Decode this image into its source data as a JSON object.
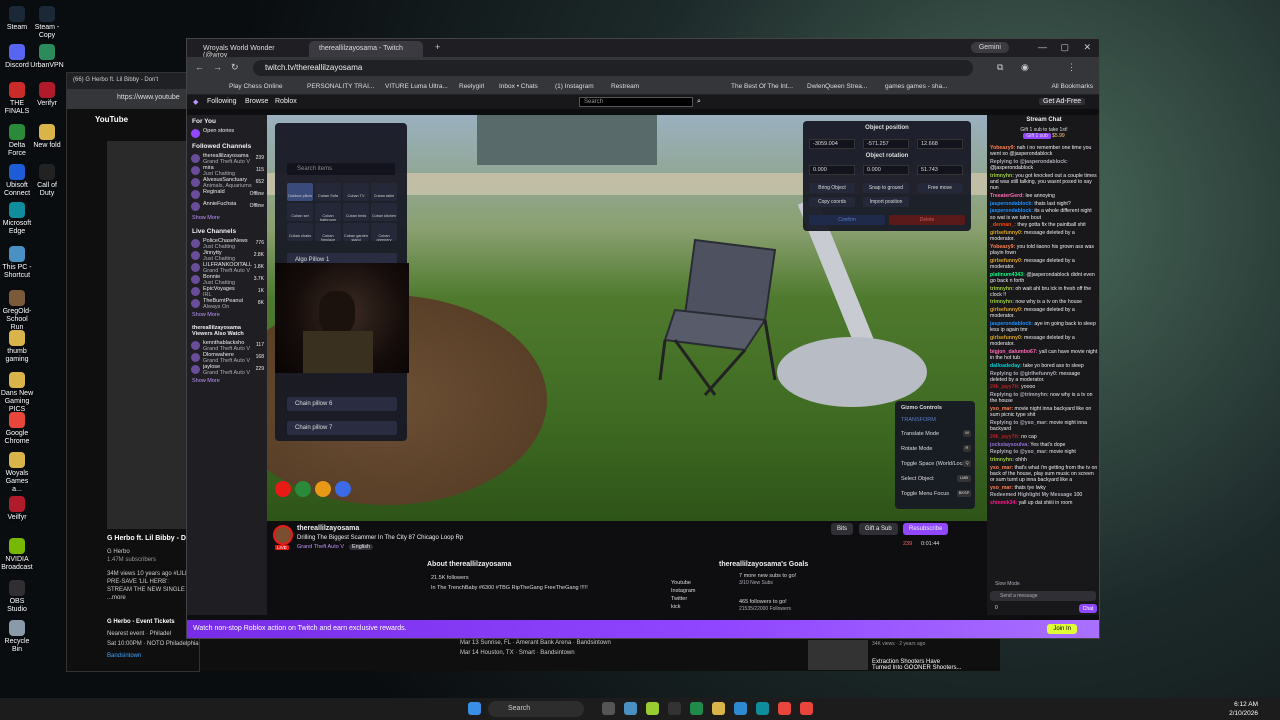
{
  "desktop_icons": [
    {
      "label": "Steam",
      "color": "#1b2838"
    },
    {
      "label": "Steam - Copy",
      "color": "#1b2838"
    },
    {
      "label": "Discord",
      "color": "#5865f2"
    },
    {
      "label": "UrbanVPN",
      "color": "#2d8a5c"
    },
    {
      "label": "THE FINALS",
      "color": "#c92a2a"
    },
    {
      "label": "Delta Force",
      "color": "#2a8a3a"
    },
    {
      "label": "Ubisoft Connect",
      "color": "#1e5bd6"
    },
    {
      "label": "Microsoft Edge",
      "color": "#0f8d9c"
    },
    {
      "label": "This PC - Shortcut",
      "color": "#4a90c2"
    },
    {
      "label": "GregOld-School Run",
      "color": "#7a5a3a"
    },
    {
      "label": "thumb gaming",
      "color": "#d9b44a"
    },
    {
      "label": "Dans New Gaming PICS",
      "color": "#d9b44a"
    },
    {
      "label": "Google Chrome",
      "color": "#e8453c"
    },
    {
      "label": "Woyals Games a...",
      "color": "#d9b44a"
    },
    {
      "label": "Veilfyr",
      "color": "#b11a2a"
    },
    {
      "label": "NVIDIA Broadcast",
      "color": "#76b900"
    },
    {
      "label": "OBS Studio",
      "color": "#302e31"
    },
    {
      "label": "Recycle Bin",
      "color": "#8a9aaa"
    },
    {
      "label": "Verifyr",
      "color": "#b11a2a"
    },
    {
      "label": "New fold",
      "color": "#d9b44a"
    },
    {
      "label": "Call of Duty",
      "color": "#222"
    }
  ],
  "youtube_window": {
    "tab": "(66) G Herbo ft. Lil Bibby - Don't",
    "url": "https://www.youtube",
    "brand": "YouTube",
    "video_title": "G Herbo ft. Lil Bibby - D",
    "channel": "G Herbo",
    "subs": "1.47M subscribers",
    "stats": "34M views  10 years ago  #LILH",
    "desc1": "PRE-SAVE 'LIL HERB':",
    "desc2": "STREAM THE NEW SINGLE 'REA",
    "more": "...more",
    "tickets_title": "G Herbo - Event Tickets",
    "event_label": "Nearest event · Philadel",
    "event_date": "Sat 10:00PM · NOTO Philadelphia",
    "event_month": "FEB",
    "event_day": "21",
    "event_src": "Bandsintown"
  },
  "browser": {
    "tabs": [
      "Wroyals World Wonder (@wroy",
      "thereallilzayosama - Twitch"
    ],
    "gemini": "Gemini",
    "url": "twitch.tv/thereallilzayosama",
    "all_bookmarks": "All Bookmarks",
    "bookmarks": [
      "Play Chess Online",
      "PERSONALITY TRAI...",
      "VITURE Luma Ultra...",
      "Reelygirl",
      "Inbox • Chats",
      "(1) Instagram",
      "Restream",
      "The Best Of The Int...",
      "DwlenQueen Strea...",
      "games games - sha..."
    ]
  },
  "twitch": {
    "nav": {
      "following": "Following",
      "browse": "Browse",
      "game": "Roblox",
      "search_placeholder": "Search",
      "ad_free": "Get Ad-Free"
    },
    "sidebar": {
      "for_you": "For You",
      "open_stories": "Open stories",
      "followed_header": "Followed Channels",
      "followed": [
        {
          "name": "thereallilzayosama",
          "game": "Grand Theft Auto V",
          "viewers": "239"
        },
        {
          "name": "mira",
          "game": "Just Chatting",
          "viewers": "115"
        },
        {
          "name": "AlvesusSanctuary",
          "game": "Animals, Aquariums",
          "viewers": "652"
        },
        {
          "name": "Reginald",
          "game": "",
          "viewers": "Offline"
        },
        {
          "name": "AnnieFuchsia",
          "game": "",
          "viewers": "Offline"
        }
      ],
      "show_more": "Show More",
      "live_header": "Live Channels",
      "live": [
        {
          "name": "PoliceChaseNews",
          "game": "Just Chatting",
          "viewers": "776"
        },
        {
          "name": "Jinnytty",
          "game": "Just Chatting",
          "viewers": "2.8K"
        },
        {
          "name": "LILFRANKOOITALL",
          "game": "Grand Theft Auto V",
          "viewers": "1.8K"
        },
        {
          "name": "Bonnie",
          "game": "Just Chatting",
          "viewers": "3.7K"
        },
        {
          "name": "EpicVoyages",
          "game": "IRL",
          "viewers": "1K"
        },
        {
          "name": "TheBurntPeanut",
          "game": "Always On",
          "viewers": "8K"
        }
      ],
      "also_watch_header": "thereallilzayosama Viewers Also Watch",
      "also": [
        {
          "name": "kennthablacksho",
          "game": "Grand Theft Auto V",
          "viewers": "117"
        },
        {
          "name": "Dlomwahere",
          "game": "Grand Theft Auto V",
          "viewers": "168"
        },
        {
          "name": "jaylose",
          "game": "Grand Theft Auto V",
          "viewers": "229"
        }
      ]
    },
    "overlay": {
      "search_items": "Search items",
      "grid_items": [
        "Outdoor pillow",
        "Cuban Sofa",
        "Cuban TV",
        "Cuban table",
        "Cuban set",
        "Cuban bathroom",
        "Cuban beds",
        "Cuban kitchen",
        "Cuban chairs",
        "Cuban fireplace",
        "Cuban garden stand",
        "Cuban greenery"
      ],
      "list_items": [
        "Algo Pillow 1",
        "Chain pillow 6",
        "Chain pillow 7"
      ],
      "object_position": "Object position",
      "pos": [
        "-3059.004",
        "-571.257",
        "12.668"
      ],
      "object_rotation": "Object rotation",
      "rot": [
        "0.000",
        "0.000",
        "51.743"
      ],
      "buttons": [
        "Bring Object",
        "Snap to ground",
        "Free move",
        "Copy coords",
        "Import position"
      ],
      "confirm": "Confirm",
      "delete": "Delete",
      "gizmo_title": "Gizmo Controls",
      "gizmo_transform": "TRANSFORM",
      "gizmo_rows": [
        "Translate Mode",
        "Rotate Mode",
        "Toggle Space (World/Local)",
        "Select Object",
        "Toggle Menu Focus"
      ],
      "gizmo_keys": [
        "W",
        "R",
        "Q",
        "LMB",
        "BKSP"
      ]
    },
    "stream": {
      "name": "thereallilzayosama",
      "title": "Drilling The Biggest Scammer In The City 87 Chicago Loop Rp",
      "game": "Grand Theft Auto V",
      "lang": "English",
      "viewers": "239",
      "uptime": "0:01:44",
      "bits": "Bits",
      "gift": "Gift a Sub",
      "resub": "Resubscribe",
      "live": "LIVE",
      "about": "About thereallilzayosama",
      "followers": "21.5K followers",
      "bio": "In The TrenchBaby #6300 #TBG RipTheGang FreeTheGang !!!!!",
      "socials": [
        "Youtube",
        "Instagram",
        "Twitter",
        "kick"
      ],
      "goals_title": "thereallilzayosama's Goals",
      "goal1": "7 more new subs to go!",
      "goal1_sub": "3/10 New Subs",
      "goal2": "465 followers to go!",
      "goal2_sub": "21535/22000 Followers"
    },
    "chat": {
      "header": "Stream Chat",
      "gift_notice": "Gift 1 sub to take 1st!",
      "gift_btn": "Gift 1 sub",
      "gift_price": "$5.99",
      "messages": [
        {
          "u": "Yobeazy9:",
          "c": "#ff7f50",
          "t": "nah i no remember one time you went so @jasperondablock"
        },
        {
          "u": "Replying to @jasperondablock:",
          "c": "#adadb8",
          "t": "@jasperondablock"
        },
        {
          "u": "trimnyhn:",
          "c": "#9acd32",
          "t": "you got knocked out a couple times and was still talking, you wasnt posed to say nun"
        },
        {
          "u": "TreeaterGerd:",
          "c": "#ff69b4",
          "t": "lee annoying"
        },
        {
          "u": "jasperondablock:",
          "c": "#1e90ff",
          "t": "thats last night?"
        },
        {
          "u": "jasperondablock:",
          "c": "#1e90ff",
          "t": "its a whole different night so wat is we talm bout"
        },
        {
          "u": "_dennan_:",
          "c": "#ff4500",
          "t": "they gotta fix the paintball shit"
        },
        {
          "u": "girlsefunny0:",
          "c": "#daa520",
          "t": "message deleted by a moderator."
        },
        {
          "u": "Yobeazy9:",
          "c": "#ff7f50",
          "t": "you told iiaono his grown ass was playin fown"
        },
        {
          "u": "girlsefunny0:",
          "c": "#daa520",
          "t": "message deleted by a moderator."
        },
        {
          "u": "platinum4343:",
          "c": "#00ff7f",
          "t": "@jasperondablock didnt even go back n forth"
        },
        {
          "u": "trimnyhn:",
          "c": "#9acd32",
          "t": "oh wait ahl bru ick in fresh off the clock !!"
        },
        {
          "u": "trimnyhn:",
          "c": "#9acd32",
          "t": "now why is a tv on the house"
        },
        {
          "u": "girlsefunny0:",
          "c": "#daa520",
          "t": "message deleted by a moderator."
        },
        {
          "u": "jasperondablock:",
          "c": "#1e90ff",
          "t": "aye im going back to sleep less ip again tmr"
        },
        {
          "u": "girlsefunny0:",
          "c": "#daa520",
          "t": "message deleted by a moderator."
        },
        {
          "u": "bigjon_dalumbo67:",
          "c": "#ff69b4",
          "t": "yall can have movie night in the hot tub"
        },
        {
          "u": "dalloadeday:",
          "c": "#00ced1",
          "t": "take yo bored ass to sleep"
        },
        {
          "u": "Replying to @girlhefunny0:",
          "c": "#adadb8",
          "t": "message deleted by a moderator."
        },
        {
          "u": "24k_jayy7tt:",
          "c": "#b22222",
          "t": "yoooo"
        },
        {
          "u": "Replying to @trimnyhn:",
          "c": "#adadb8",
          "t": "now why is a tv on the house"
        },
        {
          "u": "yso_mar:",
          "c": "#ff7f50",
          "t": "movie night inna backyard like on sum picnic type shit"
        },
        {
          "u": "Replying to @yso_mar:",
          "c": "#adadb8",
          "t": "movie night inna backyard"
        },
        {
          "u": "24k_jayy7tt:",
          "c": "#b22222",
          "t": "no cap"
        },
        {
          "u": "jockstaysoulva:",
          "c": "#9370db",
          "t": "Yes that's dope"
        },
        {
          "u": "Replying to @yso_mar:",
          "c": "#adadb8",
          "t": "movie night"
        },
        {
          "u": "trimnyhn:",
          "c": "#9acd32",
          "t": "ohhh"
        },
        {
          "u": "yso_mar:",
          "c": "#ff7f50",
          "t": "that's what i'm getting from the tv on back of the house, play sum music on screen or sum turnt up inna backyard like a"
        },
        {
          "u": "yso_mar:",
          "c": "#ff7f50",
          "t": "thats tye lwky"
        },
        {
          "u": "Redeemed Highlight My Message",
          "c": "#adadb8",
          "t": "100"
        },
        {
          "u": "shinmik34:",
          "c": "#ff1493",
          "t": "yall up dat shiiii in room"
        }
      ],
      "slow_mode": "Slow Mode",
      "placeholder": "Send a message",
      "chat_button": "Chat",
      "points": "0"
    },
    "banner": "Watch non-stop Roblox action on Twitch and earn exclusive rewards.",
    "banner_btn": "Join In"
  },
  "lower_youtube": {
    "row1": "Mar 13   Sunrise, FL · Amerant Bank Arena · Bandsintown",
    "row2": "Mar 14   Houston, TX · Smart · Bandsintown",
    "side_title1": "Extraction Shooters Have",
    "side_title2": "Turned Into GOONER Shooters...",
    "side_meta": "34K views · 2 years ago"
  },
  "taskbar": {
    "search": "Search",
    "time": "6:12 AM",
    "date": "2/10/2026"
  }
}
